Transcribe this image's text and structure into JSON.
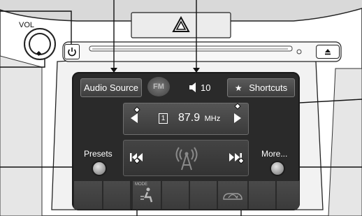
{
  "panel": {
    "vol_label": "VOL",
    "hazard_icon": "hazard-triangle-icon",
    "power_icon": "power-icon",
    "eject_icon": "eject-icon"
  },
  "screen": {
    "audio_source_label": "Audio Source",
    "fm_badge": "FM",
    "volume_value": "10",
    "shortcuts_label": "Shortcuts",
    "preset_number": "1",
    "frequency": "87.9",
    "frequency_unit": "MHz",
    "presets_label": "Presets",
    "more_label": "More...",
    "mode_label": "MODE"
  }
}
